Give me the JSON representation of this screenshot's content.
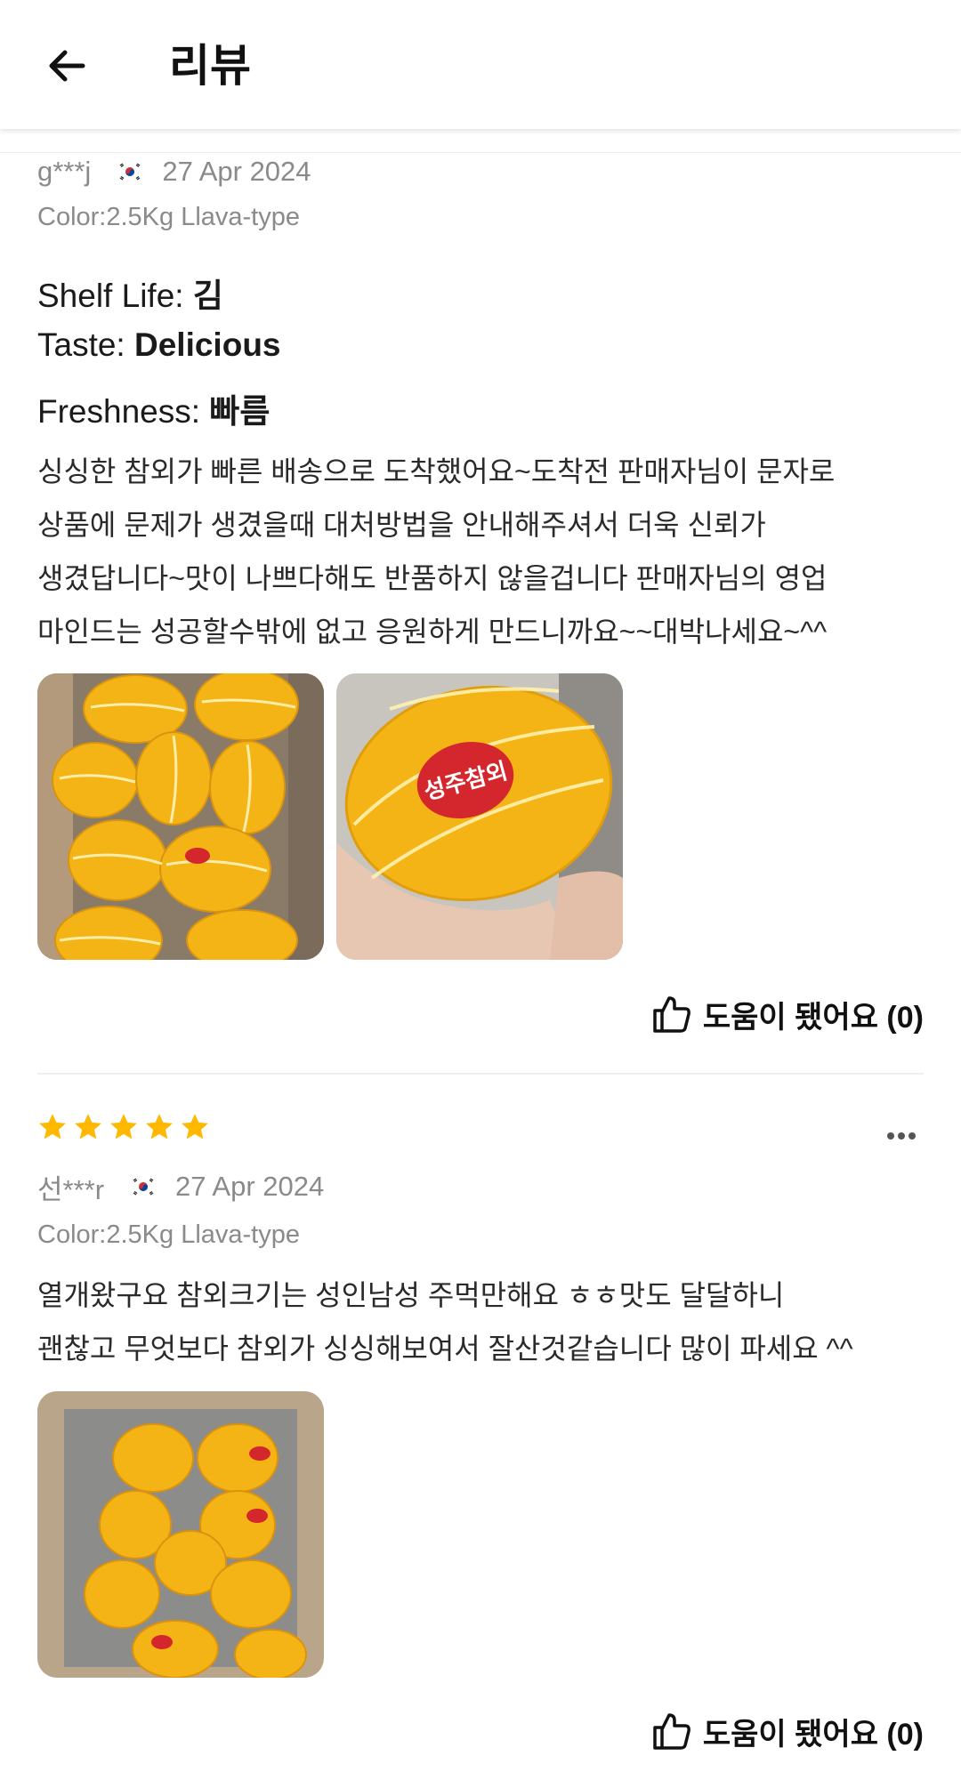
{
  "header": {
    "title": "리뷰",
    "back_icon": "arrow-left-icon"
  },
  "reviews": [
    {
      "user": "g***j",
      "country_flag": "korea-flag-icon",
      "date": "27 Apr 2024",
      "variant": "Color:2.5Kg Llava-type",
      "attributes": [
        {
          "label": "Shelf Life: ",
          "value": "김"
        },
        {
          "label": "Taste: ",
          "value": "Delicious"
        },
        {
          "label": "Freshness: ",
          "value": "빠름"
        }
      ],
      "body_lines": [
        "싱싱한 참외가 빠른 배송으로 도착했어요~도착전 판매자님이 문자로",
        "상품에  문제가 생겼을때 대처방법을 안내해주셔서 더욱 신뢰가",
        "생겼답니다~맛이 나쁘다해도 반품하지 않을겁니다 판매자님의 영업",
        "마인드는 성공할수밖에 없고 응원하게 만드니까요~~대박나세요~^^"
      ],
      "photos": [
        "melon-box-photo",
        "melon-in-hand-photo"
      ],
      "photo_label": "성주참외",
      "helpful": "도움이 됐어요 (0)"
    },
    {
      "rating": 5,
      "user": "선***r",
      "country_flag": "korea-flag-icon",
      "date": "27 Apr 2024",
      "variant": "Color:2.5Kg Llava-type",
      "body_lines": [
        "열개왔구요 참외크기는 성인남성 주먹만해요 ㅎㅎ맛도 달달하니",
        "괜찮고 무엇보다 참외가 싱싱해보여서 잘산것같습니다 많이 파세요 ^^"
      ],
      "photos": [
        "melon-box-photo"
      ],
      "helpful": "도움이 됐어요 (0)"
    }
  ],
  "colors": {
    "star": "#FFB800",
    "melon": "#F5B416",
    "meta_text": "#8a8a8a"
  }
}
